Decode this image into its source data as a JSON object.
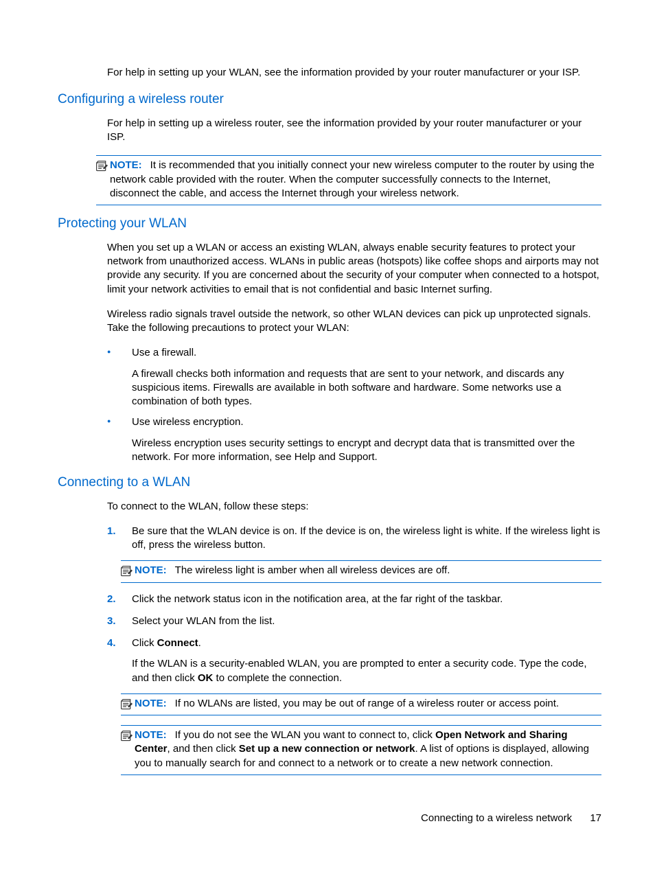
{
  "intro": {
    "p1": "For help in setting up your WLAN, see the information provided by your router manufacturer or your ISP."
  },
  "configuring": {
    "heading": "Configuring a wireless router",
    "p1": "For help in setting up a wireless router, see the information provided by your router manufacturer or your ISP.",
    "note1": {
      "label": "NOTE:",
      "text": "It is recommended that you initially connect your new wireless computer to the router by using the network cable provided with the router. When the computer successfully connects to the Internet, disconnect the cable, and access the Internet through your wireless network."
    }
  },
  "protecting": {
    "heading": "Protecting your WLAN",
    "p1": "When you set up a WLAN or access an existing WLAN, always enable security features to protect your network from unauthorized access. WLANs in public areas (hotspots) like coffee shops and airports may not provide any security. If you are concerned about the security of your computer when connected to a hotspot, limit your network activities to email that is not confidential and basic Internet surfing.",
    "p2": "Wireless radio signals travel outside the network, so other WLAN devices can pick up unprotected signals. Take the following precautions to protect your WLAN:",
    "bullet1": {
      "head": "Use a firewall.",
      "body": "A firewall checks both information and requests that are sent to your network, and discards any suspicious items. Firewalls are available in both software and hardware. Some networks use a combination of both types."
    },
    "bullet2": {
      "head": "Use wireless encryption.",
      "body": "Wireless encryption uses security settings to encrypt and decrypt data that is transmitted over the network. For more information, see Help and Support."
    }
  },
  "connecting": {
    "heading": "Connecting to a WLAN",
    "p1": "To connect to the WLAN, follow these steps:",
    "step1": "Be sure that the WLAN device is on. If the device is on, the wireless light is white. If the wireless light is off, press the wireless button.",
    "note_step1": {
      "label": "NOTE:",
      "text": "The wireless light is amber when all wireless devices are off."
    },
    "step2": "Click the network status icon in the notification area, at the far right of the taskbar.",
    "step3": "Select your WLAN from the list.",
    "step4_a": "Click ",
    "step4_b": "Connect",
    "step4_c": ".",
    "step4_body_a": "If the WLAN is a security-enabled WLAN, you are prompted to enter a security code. Type the code, and then click ",
    "step4_body_b": "OK",
    "step4_body_c": " to complete the connection.",
    "note2": {
      "label": "NOTE:",
      "text": "If no WLANs are listed, you may be out of range of a wireless router or access point."
    },
    "note3": {
      "label": "NOTE:",
      "a": "If you do not see the WLAN you want to connect to, click ",
      "b": "Open Network and Sharing Center",
      "c": ", and then click ",
      "d": "Set up a new connection or network",
      "e": ". A list of options is displayed, allowing you to manually search for and connect to a network or to create a new network connection."
    }
  },
  "footer": {
    "text": "Connecting to a wireless network",
    "page": "17"
  }
}
